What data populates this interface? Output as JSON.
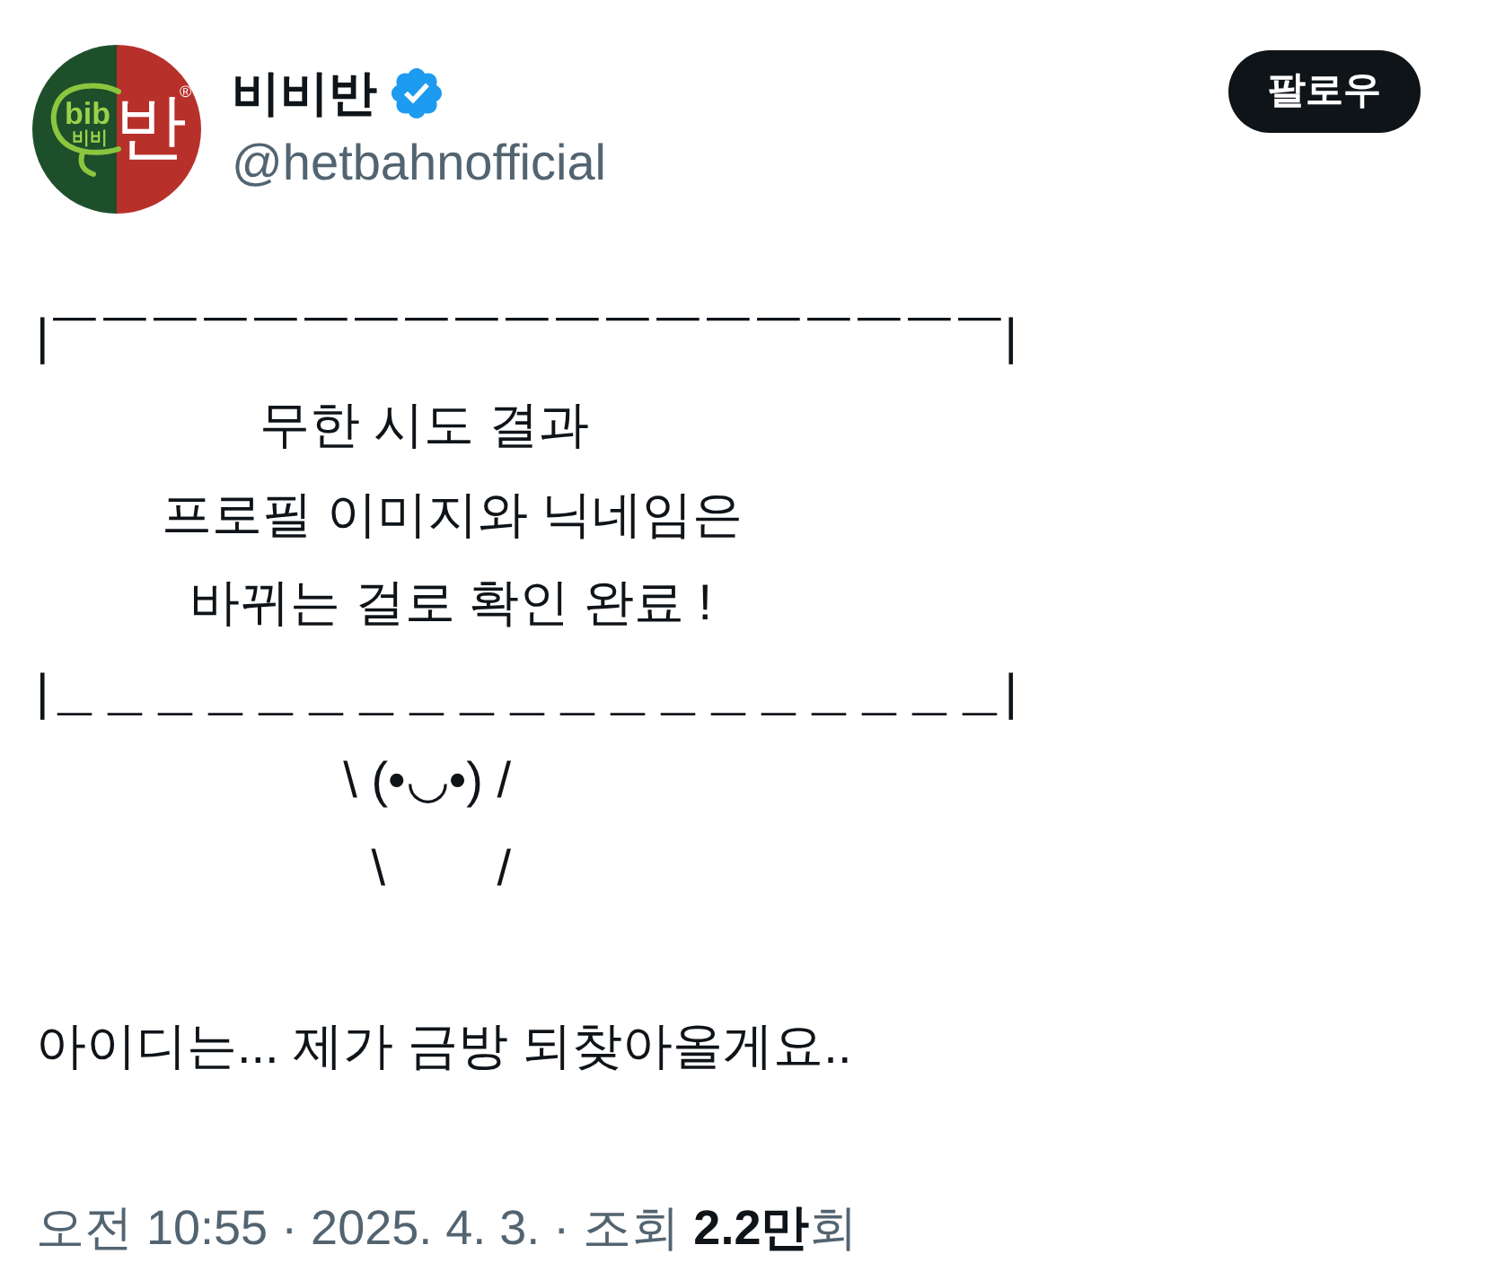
{
  "post": {
    "author": {
      "avatar": {
        "logo": "bib",
        "logo_korean": "비비",
        "logo_syllable": "반",
        "trademark": "®"
      },
      "name": "비비반",
      "verified": true,
      "handle": "@hetbahnofficial"
    },
    "follow_button": {
      "label": "팔로우"
    },
    "body": {
      "lines": [
        "|￣￣￣￣￣￣￣￣￣￣￣￣￣￣￣￣￣￣￣|",
        "                무한 시도 결과",
        "         프로필 이미지와 닉네임은",
        "           바뀌는 걸로 확인 완료 !",
        "|＿＿＿＿＿＿＿＿＿＿＿＿＿＿＿＿＿＿＿|",
        "                      \\ (•◡•) /",
        "                        \\        /"
      ],
      "message": "아이디는... 제가 금방 되찾아올게요.."
    },
    "meta": "오전 10:55 · 2025. 4. 3. · 조회 **2.2만**회"
  }
}
